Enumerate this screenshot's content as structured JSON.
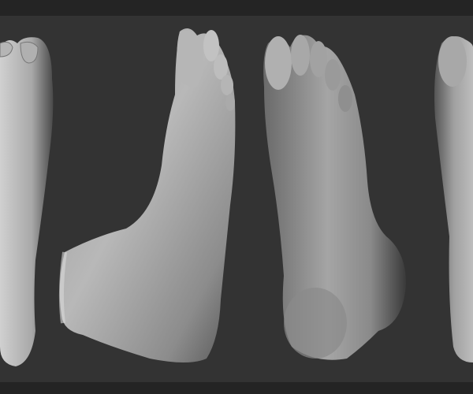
{
  "scene": {
    "subject": "foot-sculpt-renders",
    "views": [
      "top",
      "medial-side",
      "sole",
      "sole-partial"
    ],
    "colors": {
      "frame": "#252525",
      "background": "#333333",
      "clay_light": "#c8c8c8",
      "clay_mid": "#8a8a8a",
      "clay_dark": "#3a3a3a"
    }
  }
}
